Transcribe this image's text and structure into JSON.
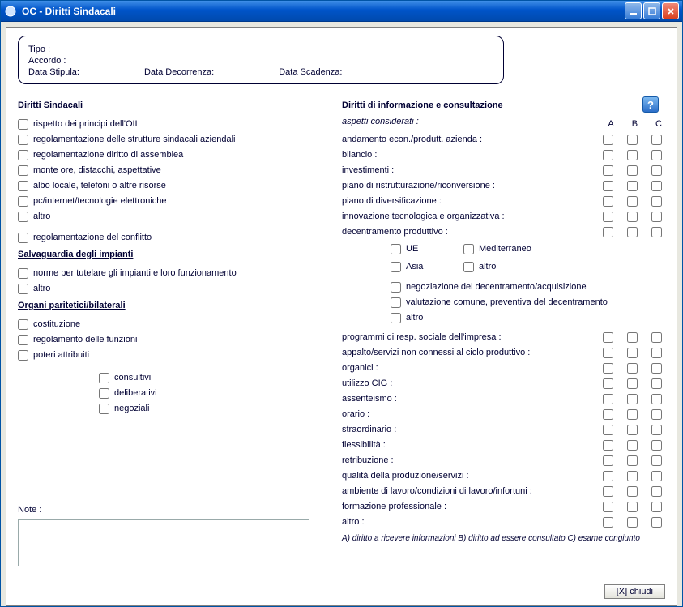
{
  "window": {
    "title": "OC - Diritti Sindacali"
  },
  "header": {
    "tipo_label": "Tipo :",
    "accordo_label": "Accordo :",
    "data_stipula_label": "Data Stipula:",
    "data_decorrenza_label": "Data Decorrenza:",
    "data_scadenza_label": "Data Scadenza:"
  },
  "sections": {
    "diritti_sindacali": {
      "title": "Diritti Sindacali",
      "items": [
        "rispetto dei principi dell'OIL",
        "regolamentazione delle strutture sindacali aziendali",
        "regolamentazione diritto di assemblea",
        "monte ore, distacchi, aspettative",
        "albo locale, telefoni o altre risorse",
        "pc/internet/tecnologie elettroniche",
        "altro",
        "regolamentazione del conflitto"
      ]
    },
    "salvaguardia": {
      "title": "Salvaguardia degli impianti",
      "items": [
        "norme per tutelare gli impianti e loro funzionamento",
        "altro"
      ]
    },
    "organi": {
      "title": "Organi paritetici/bilaterali",
      "items": [
        "costituzione",
        "regolamento delle funzioni",
        "poteri attribuiti"
      ],
      "sub_items": [
        "consultivi",
        "deliberativi",
        "negoziali"
      ]
    },
    "note_label": "Note :",
    "diritti_info": {
      "title": "Diritti di informazione e consultazione",
      "aspetti_label": "aspetti considerati :",
      "cols": {
        "a": "A",
        "b": "B",
        "c": "C"
      },
      "rows_top": [
        "andamento econ./produtt. azienda :",
        "bilancio :",
        "investimenti :",
        "piano di ristrutturazione/riconversione :",
        "piano di diversificazione :",
        "innovazione tecnologica e organizzativa :",
        "decentramento produttivo :"
      ],
      "decentr_subs_grid": [
        "UE",
        "Mediterraneo",
        "Asia",
        "altro"
      ],
      "decentr_subs_full": [
        "negoziazione del decentramento/acquisizione",
        "valutazione comune, preventiva del decentramento",
        "altro"
      ],
      "rows_bottom": [
        "programmi di resp. sociale dell'impresa :",
        "appalto/servizi non connessi al ciclo produttivo :",
        "organici :",
        "utilizzo CIG :",
        "assenteismo :",
        "orario :",
        "straordinario :",
        "flessibilità :",
        "retribuzione :",
        "qualità della produzione/servizi :",
        "ambiente di lavoro/condizioni di lavoro/infortuni :",
        "formazione professionale :",
        "altro :"
      ],
      "footnote": "A) diritto a ricevere informazioni B) diritto ad essere consultato C) esame congiunto"
    }
  },
  "footer": {
    "close_label": "[X] chiudi"
  }
}
